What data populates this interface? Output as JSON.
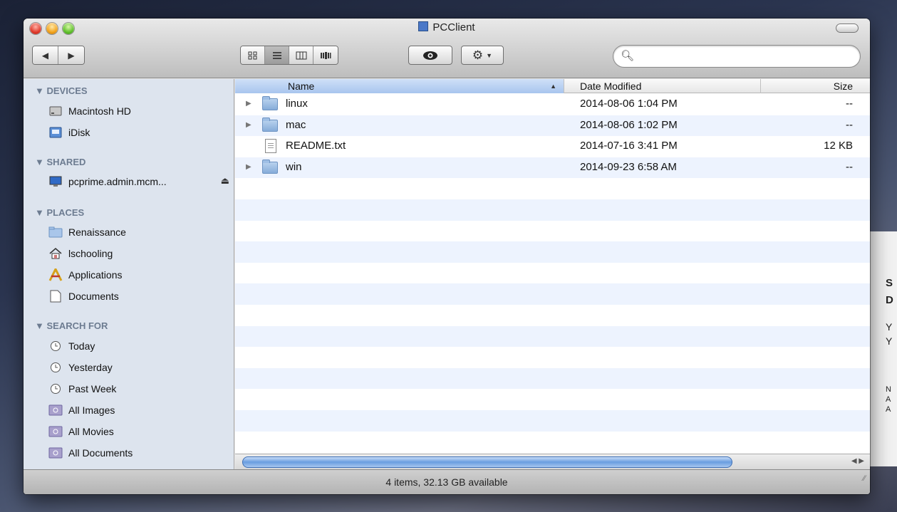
{
  "window": {
    "title": "PCClient"
  },
  "toolbar": {
    "back_label": "◀",
    "forward_label": "▶",
    "view_modes": [
      "icon-view",
      "list-view",
      "column-view",
      "coverflow-view"
    ],
    "quicklook_icon": "eye-icon",
    "action_icon": "gear-icon",
    "search_placeholder": ""
  },
  "sidebar": {
    "devices_header": "▼ DEVICES",
    "devices": [
      "Macintosh HD",
      "iDisk"
    ],
    "shared_header": "▼ SHARED",
    "shared": [
      "pcprime.admin.mcm..."
    ],
    "places_header": "▼ PLACES",
    "places": [
      "Renaissance",
      "lschooling",
      "Applications",
      "Documents"
    ],
    "search_header": "▼ SEARCH FOR",
    "search_for": [
      "Today",
      "Yesterday",
      "Past Week",
      "All Images",
      "All Movies",
      "All Documents"
    ]
  },
  "columns": {
    "name": "Name",
    "date": "Date Modified",
    "size": "Size"
  },
  "files": [
    {
      "name": "linux",
      "date": "2014-08-06 1:04 PM",
      "size": "--",
      "kind": "folder"
    },
    {
      "name": "mac",
      "date": "2014-08-06 1:02 PM",
      "size": "--",
      "kind": "folder"
    },
    {
      "name": "README.txt",
      "date": "2014-07-16 3:41 PM",
      "size": "12 KB",
      "kind": "file"
    },
    {
      "name": "win",
      "date": "2014-09-23 6:58 AM",
      "size": "--",
      "kind": "folder"
    }
  ],
  "status": "4 items, 32.13 GB available",
  "background_panel": {
    "lines": [
      "S",
      "D",
      "Y",
      "Y",
      "N",
      "A",
      "A"
    ]
  }
}
